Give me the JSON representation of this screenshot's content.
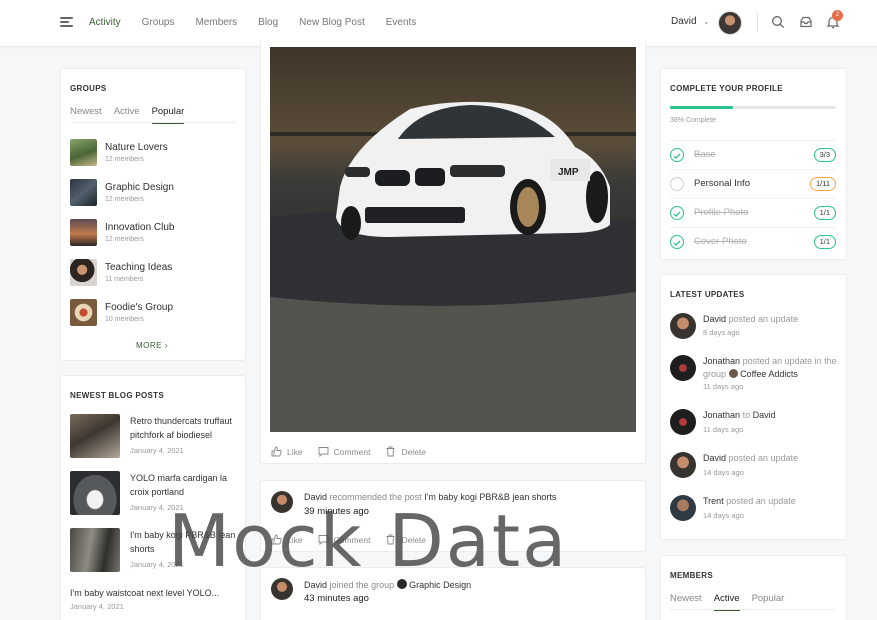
{
  "header": {
    "nav": [
      "Activity",
      "Groups",
      "Members",
      "Blog",
      "New Blog Post",
      "Events"
    ],
    "user_name": "David",
    "notification_count": "2",
    "accent": "#385c2e"
  },
  "groups_widget": {
    "title": "GROUPS",
    "tabs": [
      "Newest",
      "Active",
      "Popular"
    ],
    "active_tab": "Popular",
    "items": [
      {
        "name": "Nature Lovers",
        "meta": "12 members"
      },
      {
        "name": "Graphic Design",
        "meta": "12 members"
      },
      {
        "name": "Innovation Club",
        "meta": "12 members"
      },
      {
        "name": "Teaching Ideas",
        "meta": "11 members"
      },
      {
        "name": "Foodie's Group",
        "meta": "10 members"
      }
    ],
    "more": "MORE"
  },
  "blog_widget": {
    "title": "NEWEST BLOG POSTS",
    "items": [
      {
        "title": "Retro thundercats truffaut pitchfork af biodiesel",
        "date": "January 4, 2021"
      },
      {
        "title": "YOLO marfa cardigan la croix portland",
        "date": "January 4, 2021"
      },
      {
        "title": "I'm baby kogi PBR&B jean shorts",
        "date": "January 4, 2021"
      },
      {
        "title": "I'm baby waistcoat next level YOLO...",
        "date": "January 4, 2021"
      }
    ]
  },
  "feed": {
    "post_actions": [
      "Like",
      "Comment",
      "Delete"
    ],
    "activities": [
      {
        "actor": "David",
        "action": "recommended the post",
        "target": "I'm baby kogi PBR&B jean shorts",
        "time": "39 minutes ago"
      },
      {
        "actor": "David",
        "action": "joined the group",
        "target": "Graphic Design",
        "time": "43 minutes ago"
      }
    ]
  },
  "profile_widget": {
    "title": "COMPLETE YOUR PROFILE",
    "progress": 38,
    "progress_label": "38% Complete",
    "steps": [
      {
        "label": "Base",
        "badge": "3/3",
        "done": true
      },
      {
        "label": "Personal Info",
        "badge": "1/11",
        "done": false
      },
      {
        "label": "Profile Photo",
        "badge": "1/1",
        "done": true
      },
      {
        "label": "Cover Photo",
        "badge": "1/1",
        "done": true
      }
    ],
    "colors": {
      "done": "#2cc38b",
      "partial": "#f0a64c"
    }
  },
  "updates_widget": {
    "title": "LATEST UPDATES",
    "items": [
      {
        "actor": "David",
        "text": "posted an update",
        "time": "8 days ago"
      },
      {
        "actor": "Jonathan",
        "text": "posted an update in the group",
        "group": "Coffee Addicts",
        "time": "11 days ago"
      },
      {
        "actor": "Jonathan",
        "text": "to",
        "target": "David",
        "time": "11 days ago"
      },
      {
        "actor": "David",
        "text": "posted an update",
        "time": "14 days ago"
      },
      {
        "actor": "Trent",
        "text": "posted an update",
        "time": "14 days ago"
      }
    ]
  },
  "members_widget": {
    "title": "MEMBERS",
    "tabs": [
      "Newest",
      "Active",
      "Popular"
    ],
    "active_tab": "Active"
  },
  "watermark": "Mock Data"
}
